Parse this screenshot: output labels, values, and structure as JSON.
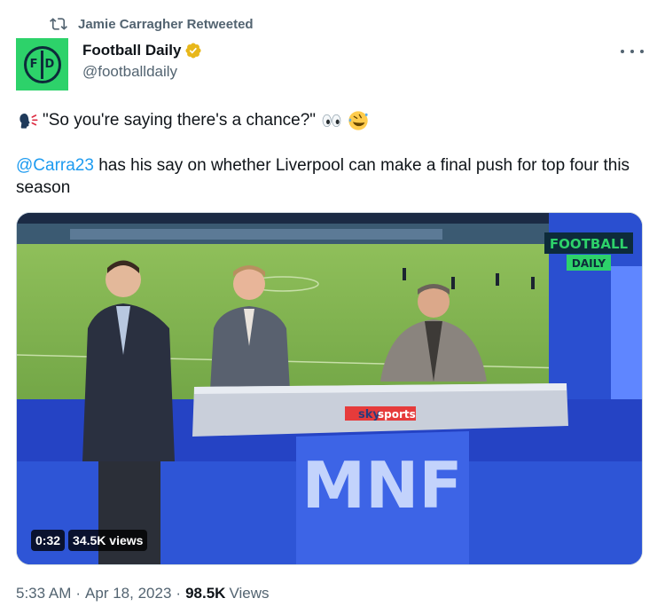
{
  "retweet": {
    "label": "Jamie Carragher Retweeted"
  },
  "author": {
    "avatar_text_left": "F",
    "avatar_text_right": "D",
    "name": "Football Daily",
    "handle": "@footballdaily",
    "verified_color": "#e8b71a",
    "avatar_color": "#2dd26a"
  },
  "tweet": {
    "line1_quote": "\"So you're saying there's a chance?\"",
    "emojis": [
      "speaking-head-icon",
      "eyes-icon",
      "rolling-laughing-icon"
    ],
    "mention": "@Carra23",
    "body": " has his say on whether Liverpool can make a final push for top four this season"
  },
  "media": {
    "brand_top": "FOOTBALL",
    "brand_bottom": "DAILY",
    "desk_logo_sky": "sky",
    "desk_logo_sports": "sports",
    "desk_text": "MNF",
    "duration": "0:32",
    "views": "34.5K views"
  },
  "meta": {
    "time": "5:33 AM",
    "date": "Apr 18, 2023",
    "views_count": "98.5K",
    "views_label": "Views"
  },
  "colors": {
    "link": "#1d9bf0",
    "secondary_text": "#536471"
  }
}
